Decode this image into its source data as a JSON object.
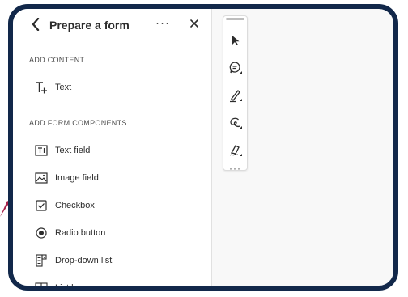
{
  "panel": {
    "title": "Prepare a form",
    "more_label": "···",
    "sections": [
      {
        "heading": "ADD CONTENT",
        "items": [
          {
            "label": "Text",
            "icon": "text-plus-icon"
          }
        ]
      },
      {
        "heading": "ADD FORM COMPONENTS",
        "items": [
          {
            "label": "Text field",
            "icon": "text-field-icon"
          },
          {
            "label": "Image field",
            "icon": "image-field-icon"
          },
          {
            "label": "Checkbox",
            "icon": "checkbox-icon"
          },
          {
            "label": "Radio button",
            "icon": "radio-button-icon"
          },
          {
            "label": "Drop-down list",
            "icon": "dropdown-list-icon"
          },
          {
            "label": "List box",
            "icon": "list-box-icon"
          }
        ]
      }
    ]
  },
  "toolbar": {
    "tools": [
      "select-arrow-icon",
      "comment-icon",
      "highlight-pen-icon",
      "draw-lasso-icon",
      "signature-icon"
    ],
    "more_label": "···"
  },
  "colors": {
    "frame": "#12284a",
    "arrow": "#a8234a",
    "panel_bg": "#ffffff",
    "canvas_bg": "#f8f8f8"
  }
}
